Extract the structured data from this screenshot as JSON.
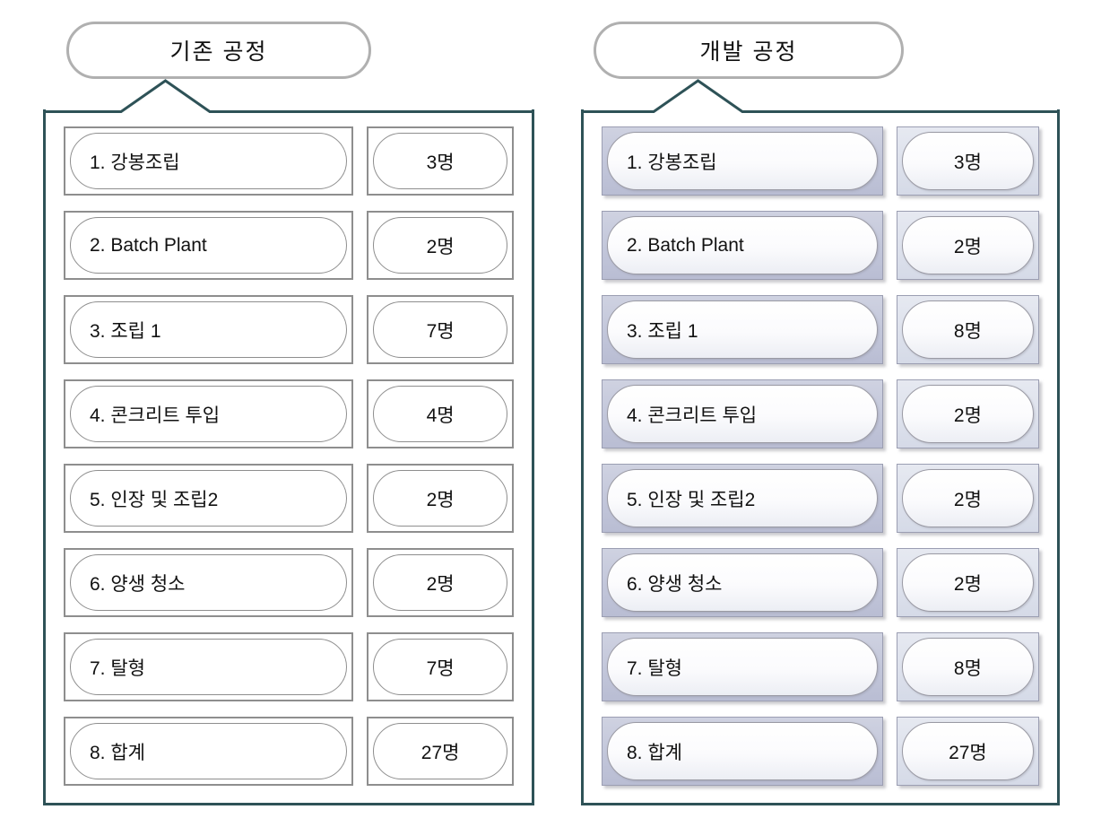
{
  "panels": [
    {
      "id": "existing-process",
      "title": "기존 공정",
      "style": "plain",
      "rows": [
        {
          "label": "1. 강봉조립",
          "count": "3명"
        },
        {
          "label": "2. Batch Plant",
          "count": "2명"
        },
        {
          "label": "3. 조립 1",
          "count": "7명"
        },
        {
          "label": "4. 콘크리트 투입",
          "count": "4명"
        },
        {
          "label": "5. 인장 및 조립2",
          "count": "2명"
        },
        {
          "label": "6. 양생 청소",
          "count": "2명"
        },
        {
          "label": "7. 탈형",
          "count": "7명"
        },
        {
          "label": "8. 합계",
          "count": "27명"
        }
      ]
    },
    {
      "id": "developed-process",
      "title": "개발 공정",
      "style": "shaded",
      "rows": [
        {
          "label": "1. 강봉조립",
          "count": "3명"
        },
        {
          "label": "2. Batch Plant",
          "count": "2명"
        },
        {
          "label": "3. 조립 1",
          "count": "8명"
        },
        {
          "label": "4. 콘크리트 투입",
          "count": "2명"
        },
        {
          "label": "5. 인장 및 조립2",
          "count": "2명"
        },
        {
          "label": "6. 양생 청소",
          "count": "2명"
        },
        {
          "label": "7. 탈형",
          "count": "8명"
        },
        {
          "label": "8. 합계",
          "count": "27명"
        }
      ]
    }
  ],
  "colors": {
    "panel_border": "#2e5257",
    "title_border": "#b0b0b0",
    "box_border": "#8e8e8e",
    "shaded_label_fill": "#c2c6da",
    "shaded_count_fill": "#dde1ec",
    "background": "#ffffff",
    "text": "#111111"
  }
}
